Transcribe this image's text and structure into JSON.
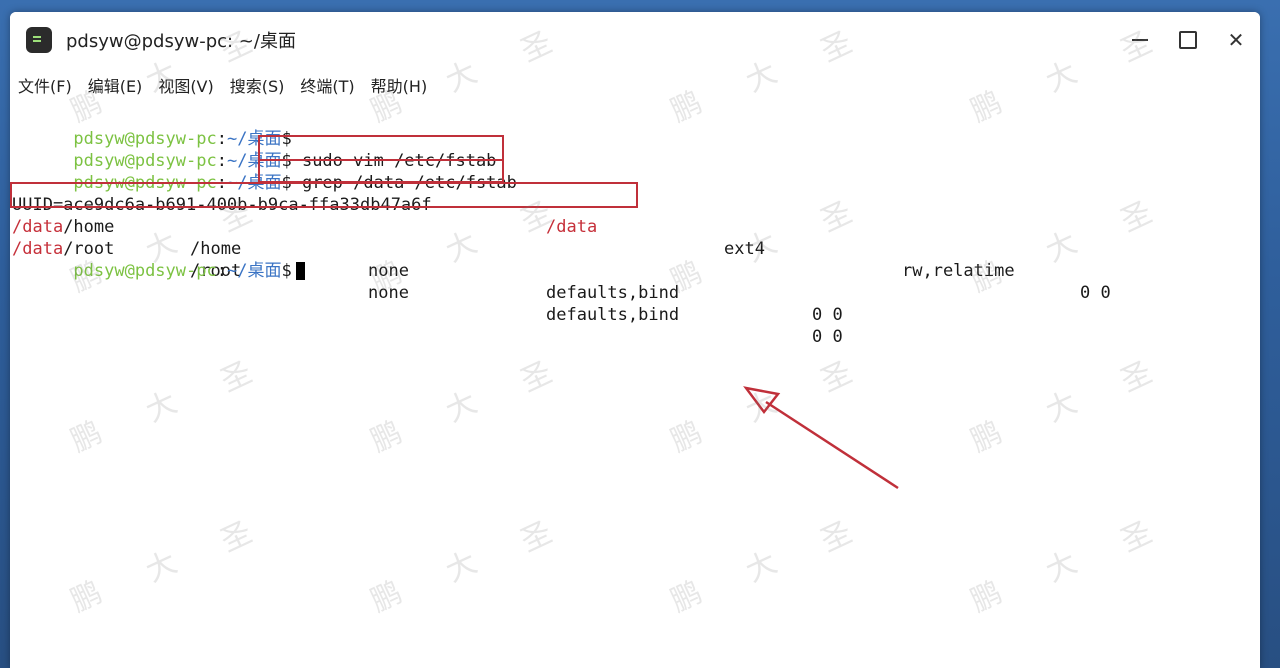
{
  "window": {
    "title": "pdsyw@pdsyw-pc: ~/桌面",
    "controls": {
      "minimize": "minimize",
      "maximize": "maximize",
      "close": "✕"
    }
  },
  "menu": [
    {
      "label": "文件(F)"
    },
    {
      "label": "编辑(E)"
    },
    {
      "label": "视图(V)"
    },
    {
      "label": "搜索(S)"
    },
    {
      "label": "终端(T)"
    },
    {
      "label": "帮助(H)"
    }
  ],
  "terminal": {
    "prompt": {
      "user": "pdsyw@pdsyw-pc",
      "sep": ":",
      "path": "~/桌面",
      "symbol": "$"
    },
    "commands": [
      "sudo vim /etc/fstab",
      "grep /data /etc/fstab"
    ],
    "output": [
      {
        "c1": "UUID=ace9dc6a-b691-400b-b9ca-ffa33db47a6f",
        "c2": "/data",
        "c3": "ext4",
        "c4": "rw,relatime",
        "c5": "0 0"
      },
      {
        "c1a": "/data",
        "c1b": "/home",
        "c2": "/home",
        "c3": "none",
        "c4": "defaults,bind",
        "c5": "0 0"
      },
      {
        "c1a": "/data",
        "c1b": "/root",
        "c2": "/root",
        "c3": "none",
        "c4": "defaults,bind",
        "c5": "0 0"
      }
    ]
  },
  "watermark": [
    "鹏",
    "大",
    "圣"
  ],
  "colors": {
    "highlight": "#c0303a",
    "prompt_user": "#7cc242",
    "prompt_path": "#3b74c4"
  }
}
